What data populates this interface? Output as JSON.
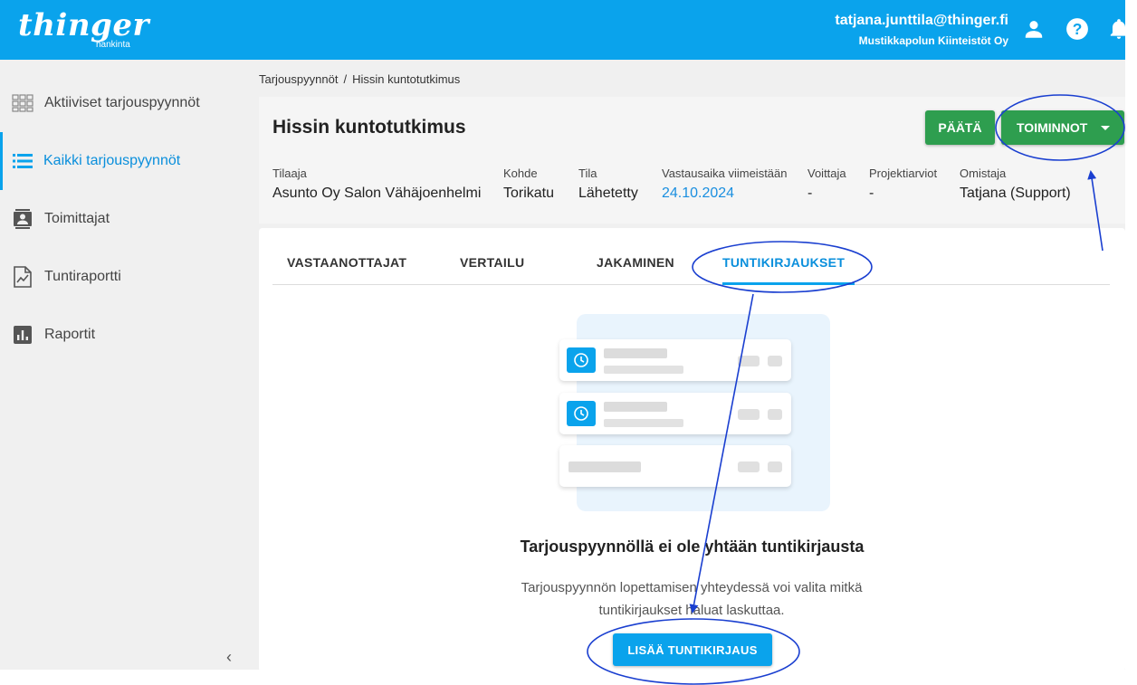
{
  "app": {
    "logo_text": "thinger",
    "logo_sub": "hankinta"
  },
  "user": {
    "email": "tatjana.junttila@thinger.fi",
    "company": "Mustikkapolun Kiinteistöt Oy"
  },
  "icons": {
    "user": "user-icon",
    "help": "help-icon",
    "bell": "bell-icon"
  },
  "sidebar": {
    "items": [
      {
        "label": "Aktiiviset tarjouspyynnöt",
        "icon": "grid-icon",
        "active": false
      },
      {
        "label": "Kaikki tarjouspyynnöt",
        "icon": "list-icon",
        "active": true
      },
      {
        "label": "Toimittajat",
        "icon": "contacts-icon",
        "active": false
      },
      {
        "label": "Tuntiraportti",
        "icon": "report-icon",
        "active": false
      },
      {
        "label": "Raportit",
        "icon": "bar-chart-icon",
        "active": false
      }
    ],
    "collapse_label": "‹"
  },
  "breadcrumb": {
    "parent": "Tarjouspyynnöt",
    "separator": "/",
    "current": "Hissin kuntotutkimus"
  },
  "header": {
    "title": "Hissin kuntotutkimus",
    "btn_close": "PÄÄTÄ",
    "btn_actions": "TOIMINNOT",
    "meta": [
      {
        "label": "Tilaaja",
        "value": "Asunto Oy Salon Vähäjoenhelmi"
      },
      {
        "label": "Kohde",
        "value": "Torikatu"
      },
      {
        "label": "Tila",
        "value": "Lähetetty"
      },
      {
        "label": "Vastausaika viimeistään",
        "value": "24.10.2024"
      },
      {
        "label": "Voittaja",
        "value": "-"
      },
      {
        "label": "Projektiarviot",
        "value": "-"
      },
      {
        "label": "Omistaja",
        "value": "Tatjana (Support)"
      }
    ]
  },
  "tabs": [
    {
      "label": "VASTAANOTTAJAT"
    },
    {
      "label": "VERTAILU"
    },
    {
      "label": "JAKAMINEN"
    },
    {
      "label": "TUNTIKIRJAUKSET",
      "active": true
    }
  ],
  "empty_state": {
    "title": "Tarjouspyynnöllä ei ole yhtään tuntikirjausta",
    "description": "Tarjouspyynnön lopettamisen yhteydessä voi valita mitkä tuntikirjaukset haluat laskuttaa.",
    "button": "LISÄÄ TUNTIKIRJAUS"
  },
  "colors": {
    "brand": "#0aa3ec",
    "green": "#2e9e4f",
    "annotation": "#1a3fd0"
  }
}
